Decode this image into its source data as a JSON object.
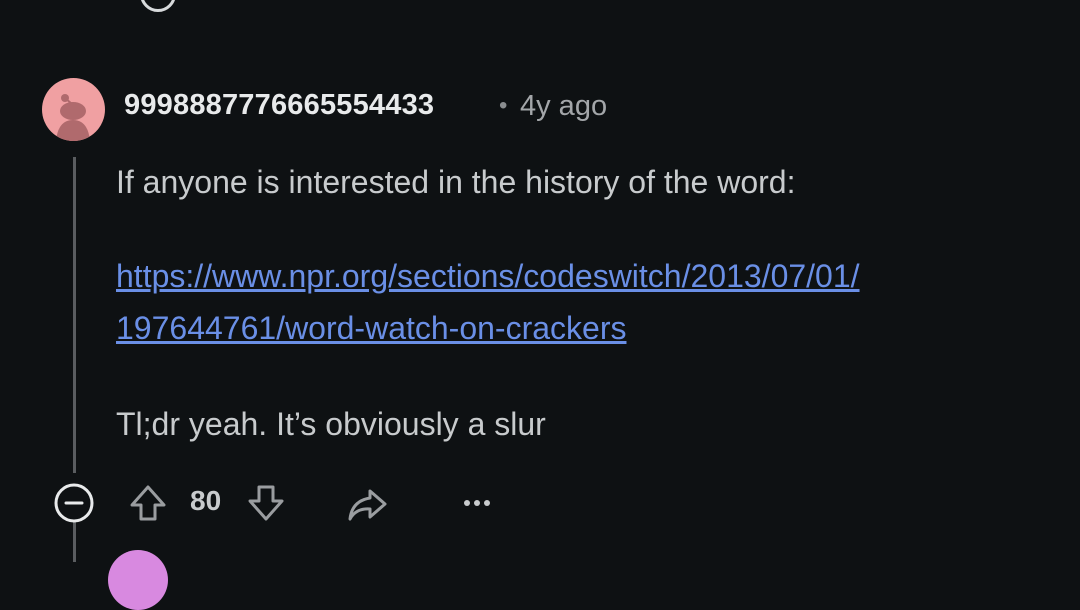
{
  "comment": {
    "username": "9998887776665554433",
    "separator": "•",
    "time_ago": "4y ago",
    "body": {
      "line1": "If anyone is interested in the history of the word:",
      "link_line1": "https://www.npr.org/sections/codeswitch/2013/07/01/",
      "link_line2": "197644761/word-watch-on-crackers",
      "line3": "Tl;dr yeah. It’s obviously a slur"
    },
    "vote_count": "80"
  },
  "icons": {
    "avatar": "reddit-snoo-avatar",
    "collapse": "collapse-minus-icon",
    "upvote": "upvote-arrow-icon",
    "downvote": "downvote-arrow-icon",
    "share": "share-icon",
    "more": "more-dots-icon"
  },
  "colors": {
    "background": "#0e1113",
    "link": "#6a8fe6",
    "avatar": "#f0a0a2"
  }
}
